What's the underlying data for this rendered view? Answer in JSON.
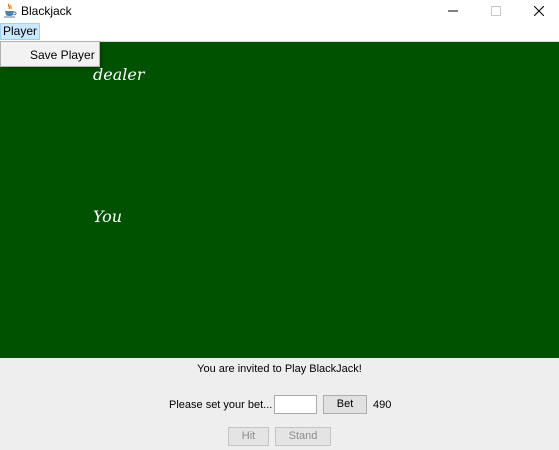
{
  "window": {
    "title": "Blackjack",
    "icon": "java-cup-icon",
    "controls": [
      "minimize-icon",
      "maximize-icon",
      "close-icon"
    ]
  },
  "menubar": {
    "items": [
      {
        "label": "Player",
        "open": true
      }
    ]
  },
  "dropdown": {
    "items": [
      {
        "label": "Save Player"
      }
    ]
  },
  "table": {
    "background_color": "#005200",
    "dealer_label": "dealer",
    "player_label": "You"
  },
  "controls": {
    "message": "You are invited to Play BlackJack!",
    "bet_prompt": "Please set your bet...",
    "bet_input_value": "",
    "bet_button": "Bet",
    "balance": "490",
    "hit_button": "Hit",
    "stand_button": "Stand",
    "hit_enabled": false,
    "stand_enabled": false
  }
}
